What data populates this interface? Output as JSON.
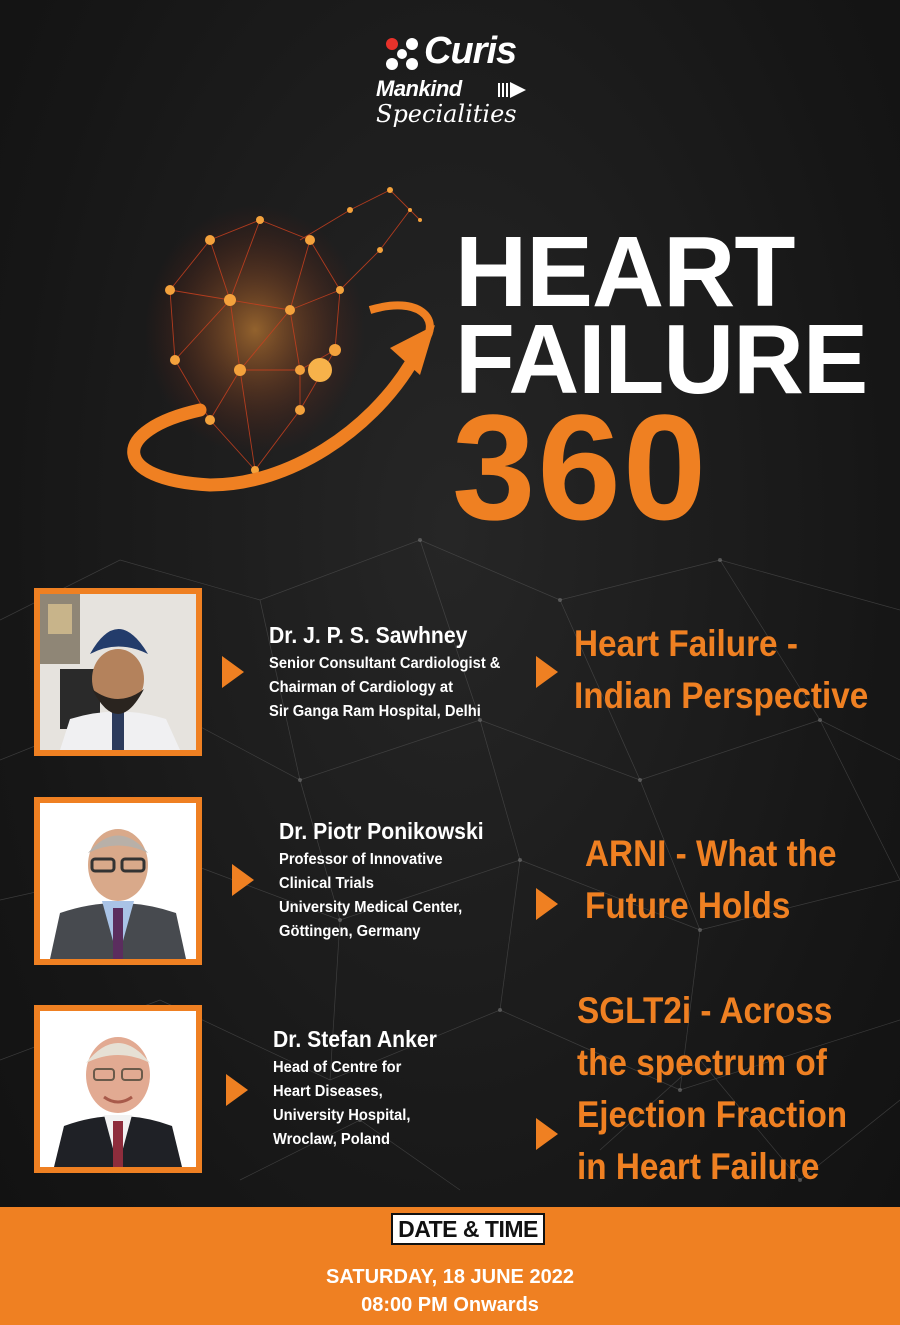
{
  "brand": {
    "curis": "Curis",
    "mankind": "Mankind",
    "specialities": "Specialities"
  },
  "title": {
    "line1": "HEART",
    "line2": "FAILURE",
    "line3": "360"
  },
  "speakers": [
    {
      "name": "Dr. J. P. S. Sawhney",
      "desc": [
        "Senior Consultant Cardiologist &",
        "Chairman of Cardiology at",
        "Sir Ganga Ram Hospital, Delhi"
      ],
      "topic": [
        "Heart Failure -",
        "Indian Perspective"
      ]
    },
    {
      "name": "Dr. Piotr Ponikowski",
      "desc": [
        "Professor of Innovative",
        "Clinical Trials",
        "University Medical Center,",
        "Göttingen, Germany"
      ],
      "topic": [
        "ARNI - What the",
        "Future Holds"
      ]
    },
    {
      "name": "Dr. Stefan Anker",
      "desc": [
        "Head of Centre for",
        "Heart Diseases,",
        "University Hospital,",
        "Wroclaw, Poland"
      ],
      "topic": [
        "SGLT2i - Across",
        "the spectrum of",
        "Ejection Fraction",
        "in Heart Failure"
      ]
    }
  ],
  "footer": {
    "badge": "DATE & TIME",
    "date": "SATURDAY, 18 JUNE 2022",
    "time": "08:00 PM Onwards"
  },
  "colors": {
    "accent": "#ef8022",
    "background": "#1b1b1b",
    "text": "#ffffff"
  }
}
